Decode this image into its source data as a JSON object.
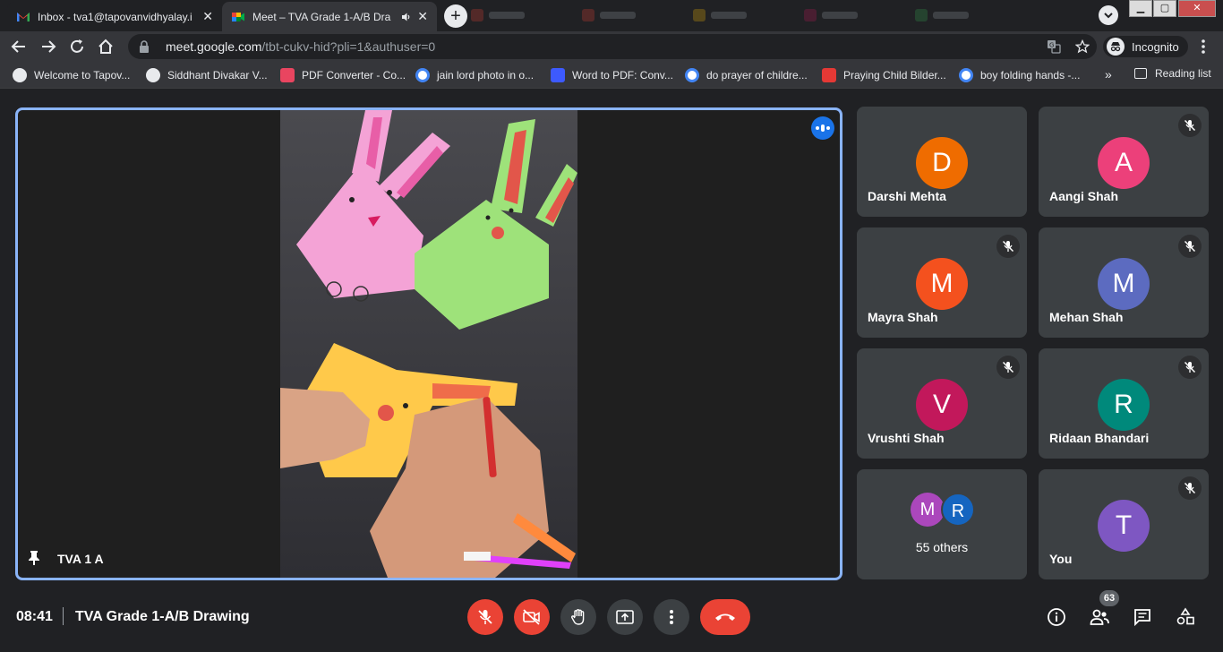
{
  "browser": {
    "tabs": [
      {
        "title": "Inbox - tva1@tapovanvidhyalay.i",
        "active": false
      },
      {
        "title": "Meet – TVA Grade 1-A/B Dra",
        "active": true
      }
    ],
    "address": {
      "host": "meet.google.com",
      "path": "/tbt-cukv-hid?pli=1&authuser=0"
    },
    "incognito_label": "Incognito",
    "bookmarks": [
      "Welcome to Tapov...",
      "Siddhant Divakar V...",
      "PDF Converter - Co...",
      "jain lord photo in o...",
      "Word to PDF: Conv...",
      "do prayer of childre...",
      "Praying Child Bilder...",
      "boy folding hands -..."
    ],
    "bookmarks_more": "»",
    "reading_list": "Reading list",
    "window_controls": {
      "minimize": "▁",
      "maximize": "▢",
      "close": "✕"
    }
  },
  "stage": {
    "label": "TVA 1 A"
  },
  "participants": [
    {
      "name": "Darshi Mehta",
      "initial": "D",
      "color": "#ef6c00",
      "muted": false
    },
    {
      "name": "Aangi Shah",
      "initial": "A",
      "color": "#ec407a",
      "muted": true
    },
    {
      "name": "Mayra Shah",
      "initial": "M",
      "color": "#f4511e",
      "muted": true
    },
    {
      "name": "Mehan Shah",
      "initial": "M",
      "color": "#5c6bc0",
      "muted": true
    },
    {
      "name": "Vrushti Shah",
      "initial": "V",
      "color": "#c2185b",
      "muted": true
    },
    {
      "name": "Ridaan Bhandari",
      "initial": "R",
      "color": "#00897b",
      "muted": true
    },
    {
      "name": "You",
      "initial": "T",
      "color": "#7e57c2",
      "muted": true
    }
  ],
  "others": {
    "label": "55 others",
    "avatars": [
      {
        "initial": "M",
        "color": "#ab47bc"
      },
      {
        "initial": "R",
        "color": "#1565c0"
      }
    ]
  },
  "bottom": {
    "time": "08:41",
    "meeting_title": "TVA Grade 1-A/B Drawing",
    "people_count": "63"
  }
}
